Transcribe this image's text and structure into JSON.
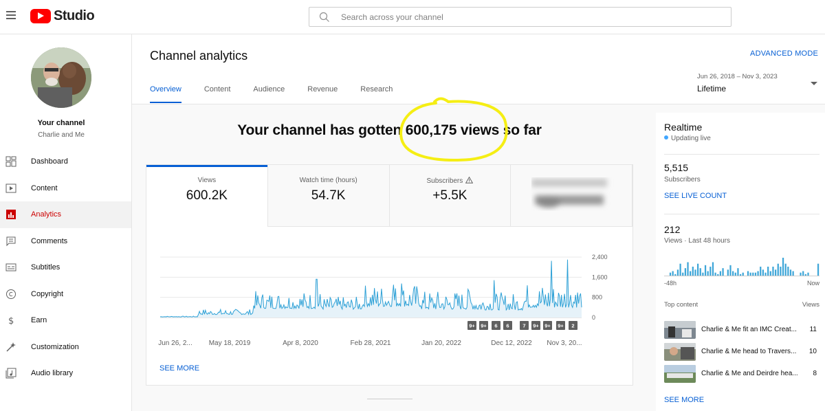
{
  "header": {
    "logo_text": "Studio",
    "search_placeholder": "Search across your channel"
  },
  "sidebar": {
    "channel_title": "Your channel",
    "channel_name": "Charlie and Me",
    "items": [
      {
        "label": "Dashboard",
        "icon": "dashboard-icon",
        "active": false
      },
      {
        "label": "Content",
        "icon": "content-icon",
        "active": false
      },
      {
        "label": "Analytics",
        "icon": "analytics-icon",
        "active": true
      },
      {
        "label": "Comments",
        "icon": "comments-icon",
        "active": false
      },
      {
        "label": "Subtitles",
        "icon": "subtitles-icon",
        "active": false
      },
      {
        "label": "Copyright",
        "icon": "copyright-icon",
        "active": false
      },
      {
        "label": "Earn",
        "icon": "earn-icon",
        "active": false
      },
      {
        "label": "Customization",
        "icon": "customization-icon",
        "active": false
      },
      {
        "label": "Audio library",
        "icon": "audio-library-icon",
        "active": false
      }
    ]
  },
  "main": {
    "title": "Channel analytics",
    "advanced_mode": "ADVANCED MODE",
    "tabs": [
      "Overview",
      "Content",
      "Audience",
      "Revenue",
      "Research"
    ],
    "active_tab": "Overview",
    "date_range": "Jun 26, 2018 – Nov 3, 2023",
    "period": "Lifetime",
    "headline": "Your channel has gotten 600,175 views so far",
    "metrics": [
      {
        "label": "Views",
        "value": "600.2K"
      },
      {
        "label": "Watch time (hours)",
        "value": "54.7K"
      },
      {
        "label": "Subscribers",
        "value": "+5.5K"
      }
    ],
    "see_more": "SEE MORE"
  },
  "chart_data": {
    "type": "line",
    "x_tick_labels": [
      "Jun 26, 2...",
      "May 18, 2019",
      "Apr 8, 2020",
      "Feb 28, 2021",
      "Jan 20, 2022",
      "Dec 12, 2022",
      "Nov 3, 20..."
    ],
    "y_tick_labels": [
      "2,400",
      "1,600",
      "800",
      "0"
    ],
    "ylim": [
      0,
      2400
    ],
    "grid": true,
    "color": "#2ca0d6",
    "segments": [
      {
        "start": 0.0,
        "end": 0.09,
        "base": 25,
        "amp": 30
      },
      {
        "start": 0.09,
        "end": 0.22,
        "base": 120,
        "amp": 220
      },
      {
        "start": 0.22,
        "end": 0.38,
        "base": 360,
        "amp": 700
      },
      {
        "start": 0.38,
        "end": 0.48,
        "base": 330,
        "amp": 500
      },
      {
        "start": 0.48,
        "end": 0.62,
        "base": 440,
        "amp": 900
      },
      {
        "start": 0.62,
        "end": 0.75,
        "base": 330,
        "amp": 750
      },
      {
        "start": 0.75,
        "end": 0.86,
        "base": 300,
        "amp": 700
      },
      {
        "start": 0.86,
        "end": 1.0,
        "base": 400,
        "amp": 1000
      }
    ],
    "spikes": [
      {
        "x": 0.371,
        "v": 1520
      },
      {
        "x": 0.553,
        "v": 1300
      },
      {
        "x": 0.573,
        "v": 1350
      },
      {
        "x": 0.73,
        "v": 1120
      },
      {
        "x": 0.793,
        "v": 1480
      },
      {
        "x": 0.929,
        "v": 2250
      },
      {
        "x": 0.966,
        "v": 2300
      },
      {
        "x": 0.985,
        "v": 900
      }
    ],
    "annotations": [
      "9+",
      "9+",
      "6",
      "6",
      "7",
      "9+",
      "9+",
      "9+",
      "2"
    ]
  },
  "realtime": {
    "title": "Realtime",
    "status": "Updating live",
    "subscribers_value": "5,515",
    "subscribers_label": "Subscribers",
    "see_live_count": "SEE LIVE COUNT",
    "views_value": "212",
    "views_label": "Views · Last 48 hours",
    "axis_left": "-48h",
    "axis_right": "Now",
    "top_content_label": "Top content",
    "top_content_views": "Views",
    "top_content": [
      {
        "title": "Charlie & Me fit an IMC Creat...",
        "views": "11"
      },
      {
        "title": "Charlie & Me head to Travers...",
        "views": "10"
      },
      {
        "title": "Charlie & Me and Deirdre hea...",
        "views": "8"
      }
    ],
    "see_more": "SEE MORE",
    "bars": [
      0,
      0,
      2,
      3,
      1,
      4,
      8,
      2,
      5,
      9,
      3,
      6,
      4,
      8,
      5,
      2,
      7,
      3,
      6,
      9,
      2,
      1,
      3,
      5,
      0,
      4,
      7,
      3,
      2,
      5,
      1,
      2,
      0,
      3,
      2,
      2,
      2,
      3,
      6,
      4,
      2,
      6,
      3,
      6,
      4,
      8,
      6,
      12,
      8,
      6,
      4,
      3,
      0,
      0,
      2,
      3,
      1,
      2,
      0,
      0,
      0,
      8
    ]
  }
}
